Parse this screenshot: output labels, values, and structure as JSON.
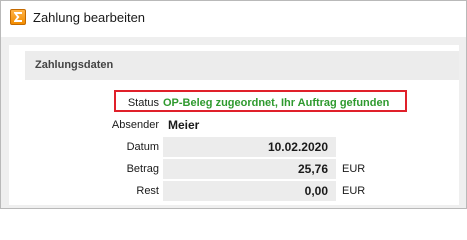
{
  "window": {
    "title": "Zahlung bearbeiten"
  },
  "section": {
    "title": "Zahlungsdaten"
  },
  "fields": {
    "status": {
      "label": "Status",
      "value": "OP-Beleg zugeordnet, Ihr Auftrag gefunden"
    },
    "absender": {
      "label": "Absender",
      "value": "Meier"
    },
    "datum": {
      "label": "Datum",
      "value": "10.02.2020"
    },
    "betrag": {
      "label": "Betrag",
      "value": "25,76",
      "unit": "EUR"
    },
    "rest": {
      "label": "Rest",
      "value": "0,00",
      "unit": "EUR"
    }
  },
  "colors": {
    "status_text": "#2e9a2e",
    "highlight": "#e0202a",
    "app_icon": "#f28c00"
  },
  "icons": {
    "app": "sum-sigma-icon"
  }
}
